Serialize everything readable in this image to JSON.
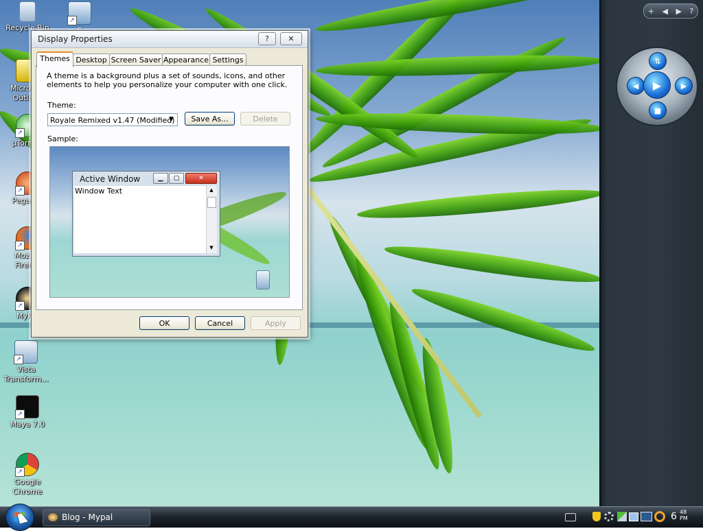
{
  "desktop_icons": [
    {
      "label": "Recycle Bin",
      "icon": "recycle-bin-icon"
    },
    {
      "label": "E",
      "icon": "shortcut-icon"
    },
    {
      "label": "Microsoft Outlook",
      "icon": "outlook-icon"
    },
    {
      "label": "µTorrent",
      "icon": "utorrent-icon"
    },
    {
      "label": "Pegasus",
      "icon": "pegasus-icon"
    },
    {
      "label": "Mozilla Firefox",
      "icon": "firefox-icon"
    },
    {
      "label": "MyPal",
      "icon": "mypal-icon"
    },
    {
      "label": "Vista Transform...",
      "icon": "vista-transformation-icon"
    },
    {
      "label": "Maya 7.0",
      "icon": "maya-icon"
    },
    {
      "label": "Google Chrome",
      "icon": "chrome-icon"
    }
  ],
  "dialog": {
    "title": "Display Properties",
    "help_glyph": "?",
    "close_glyph": "✕",
    "tabs": [
      "Themes",
      "Desktop",
      "Screen Saver",
      "Appearance",
      "Settings"
    ],
    "active_tab": "Themes",
    "description": "A theme is a background plus a set of sounds, icons, and other elements to help you personalize your computer with one click.",
    "theme_label": "Theme:",
    "theme_value": "Royale Remixed v1.47 (Modified)",
    "save_as": "Save As...",
    "delete": "Delete",
    "sample_label": "Sample:",
    "sample_window_title": "Active Window",
    "sample_window_text": "Window Text",
    "ok": "OK",
    "cancel": "Cancel",
    "apply": "Apply"
  },
  "sidebar": {
    "nav": [
      "+",
      "◀",
      "▶",
      "?"
    ]
  },
  "taskbar": {
    "start_icon": "windows-orb-icon",
    "task_label": "Blog - Mypal",
    "clock_hour": "6",
    "clock_minute": "48",
    "clock_ampm": "PM"
  },
  "colors": {
    "accent": "#e68b2c",
    "taskbar": "#1f262e",
    "sidebar": "#2e3944"
  }
}
